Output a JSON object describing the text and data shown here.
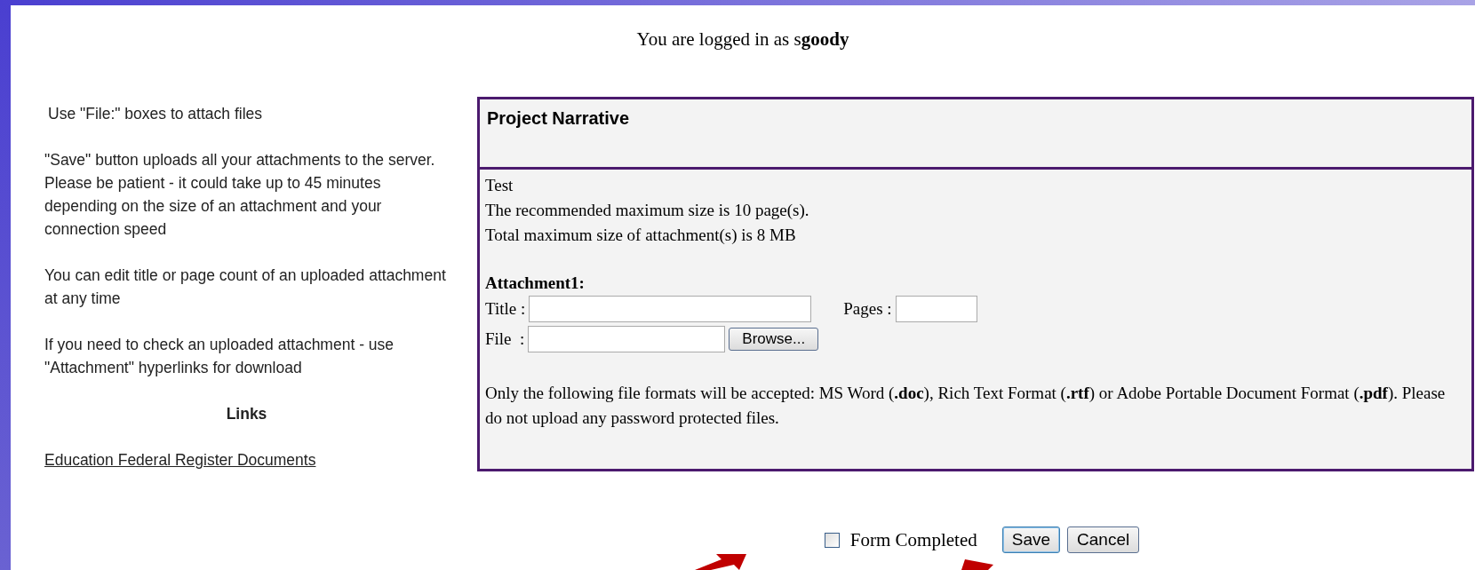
{
  "login": {
    "text": "You are logged in as s**goody**"
  },
  "sidebar": {
    "paragraphs": [
      "Use \"File:\" boxes to attach files",
      "\"Save\" button uploads all your attachments to the server. Please be patient - it could take up to 45 minutes depending on the size of an attachment and your connection speed",
      "You can edit title or page count of an uploaded attachment at any time",
      "If you need to check an uploaded attachment - use \"Attachment\" hyperlinks for download"
    ],
    "links_heading": "Links",
    "links": [
      "Education Federal Register Documents"
    ]
  },
  "form": {
    "title": "Project Narrative",
    "info_lines": [
      "Test",
      "The recommended maximum size is 10 page(s).",
      "Total maximum size of attachment(s) is 8 MB"
    ],
    "attachment_label": "Attachment1:",
    "title_label": "Title :",
    "pages_label": "Pages :",
    "file_label": "File  :",
    "browse_button": "Browse...",
    "note": "Only the following file formats will be accepted: MS Word (**.doc**), Rich Text Format (**.rtf**) or Adobe Portable Document Format (**.pdf**). Please do not upload any password protected files."
  },
  "footer": {
    "form_completed": {
      "label": "Form Completed",
      "checked": false
    },
    "buttons": [
      "Save",
      "Cancel"
    ]
  }
}
